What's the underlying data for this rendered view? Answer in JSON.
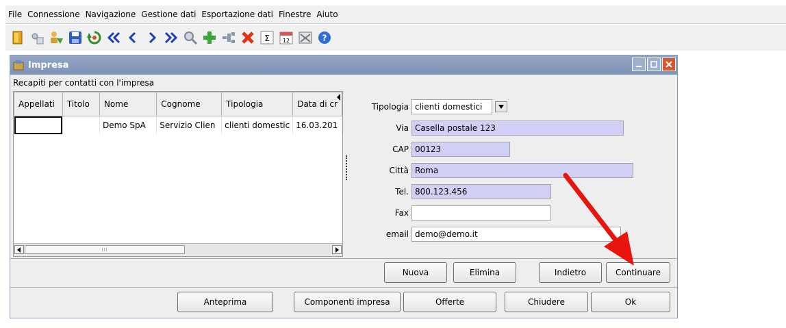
{
  "menu": {
    "items": [
      "File",
      "Connessione",
      "Navigazione",
      "Gestione dati",
      "Esportazione dati",
      "Finestre",
      "Aiuto"
    ]
  },
  "toolbar": {
    "icons": [
      "exit-icon",
      "properties-icon",
      "users-icon",
      "save-icon",
      "refresh-icon",
      "first-record-icon",
      "previous-record-icon",
      "next-record-icon",
      "last-record-icon",
      "search-icon",
      "add-icon",
      "connect-icon",
      "delete-icon",
      "sum-icon",
      "calendar-icon",
      "email-icon",
      "help-icon"
    ],
    "calendar_text": "12",
    "sum_text": "Σ"
  },
  "window": {
    "title": "Impresa",
    "section_label": "Recapiti per contatti con l'impresa"
  },
  "table": {
    "columns": [
      "Appellati",
      "Titolo",
      "Nome",
      "Cognome",
      "Tipologia",
      "Data di cr"
    ],
    "rows": [
      [
        "",
        "",
        "Demo SpA",
        "Servizio Clien",
        "clienti domestic",
        "16.03.201"
      ]
    ],
    "scroll_grip": "III"
  },
  "form": {
    "tipologia_label": "Tipologia",
    "tipologia_value": "clienti domestici",
    "via_label": "Via",
    "via_value": "Casella postale 123",
    "cap_label": "CAP",
    "cap_value": "00123",
    "citta_label": "Città",
    "citta_value": "Roma",
    "tel_label": "Tel.",
    "tel_value": "800.123.456",
    "fax_label": "Fax",
    "fax_value": "",
    "email_label": "email",
    "email_value": "demo@demo.it"
  },
  "buttons_row1": {
    "nuova": "Nuova",
    "elimina": "Elimina",
    "indietro": "Indietro",
    "continuare": "Continuare"
  },
  "buttons_row2": {
    "anteprima": "Anteprima",
    "componenti": "Componenti impresa",
    "offerte": "Offerte",
    "chiudere": "Chiudere",
    "ok": "Ok"
  },
  "colors": {
    "title_bar": "#8699bb",
    "highlight_field": "#d0d0f6",
    "annotation_arrow": "#e8150f"
  }
}
